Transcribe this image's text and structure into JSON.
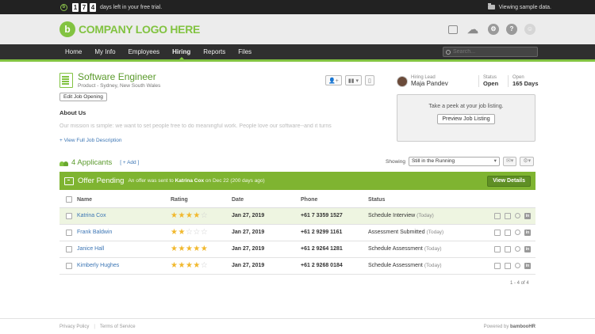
{
  "trial": {
    "digits": [
      "1",
      "7",
      "4"
    ],
    "text": "days left in your free trial.",
    "right_text": "Viewing sample data."
  },
  "header": {
    "logo_letter": "b",
    "logo_text": "COMPANY LOGO HERE"
  },
  "nav": {
    "items": [
      "Home",
      "My Info",
      "Employees",
      "Hiring",
      "Reports",
      "Files"
    ],
    "active": "Hiring",
    "search_placeholder": "Search..."
  },
  "job": {
    "title": "Software Engineer",
    "subtitle": "Product - Sydney, New South Wales",
    "edit_label": "Edit Job Opening",
    "about_title": "About Us",
    "about_text": "Our mission is simple: we want to set people free to do meaningful work. People love our software--and it turns",
    "full_desc_label": "View Full Job Description"
  },
  "hiring_lead": {
    "label": "Hiring Lead",
    "name": "Maja Pandev"
  },
  "status": {
    "label": "Status",
    "value": "Open"
  },
  "open": {
    "label": "Open",
    "value": "165 Days"
  },
  "peek": {
    "text": "Take a peek at your job listing.",
    "button": "Preview Job Listing"
  },
  "applicants": {
    "count_label": "4 Applicants",
    "add_label": "[ + Add ]"
  },
  "showing": {
    "label": "Showing",
    "value": "Still in the Running"
  },
  "offer": {
    "title": "Offer Pending",
    "msg_prefix": "An offer was sent to",
    "msg_name": "Katrina Cox",
    "msg_suffix": "on Dec 22 (200 days ago)",
    "button": "View Details"
  },
  "table": {
    "headers": {
      "name": "Name",
      "rating": "Rating",
      "date": "Date",
      "phone": "Phone",
      "status": "Status"
    },
    "rows": [
      {
        "name": "Katrina Cox",
        "rating": 4,
        "date": "Jan 27, 2019",
        "phone": "+61 7 3359 1527",
        "status": "Schedule Interview",
        "status_sub": "(Today)"
      },
      {
        "name": "Frank Baldwin",
        "rating": 2,
        "date": "Jan 27, 2019",
        "phone": "+61 2 9299 1161",
        "status": "Assessment Submitted",
        "status_sub": "(Today)"
      },
      {
        "name": "Janice Hall",
        "rating": 5,
        "date": "Jan 27, 2019",
        "phone": "+61 2 9264 1281",
        "status": "Schedule Assessment",
        "status_sub": "(Today)"
      },
      {
        "name": "Kimberly Hughes",
        "rating": 4,
        "date": "Jan 27, 2019",
        "phone": "+61 2 9268 0184",
        "status": "Schedule Assessment",
        "status_sub": "(Today)"
      }
    ],
    "pager": "1 - 4 of 4"
  },
  "footer": {
    "privacy": "Privacy Policy",
    "terms": "Terms of Service",
    "powered": "Powered by",
    "brand": "bambooHR"
  },
  "colors": {
    "accent": "#82c341",
    "offer_bar": "#7fb431",
    "link": "#3b75b4",
    "star": "#f1b82d"
  }
}
